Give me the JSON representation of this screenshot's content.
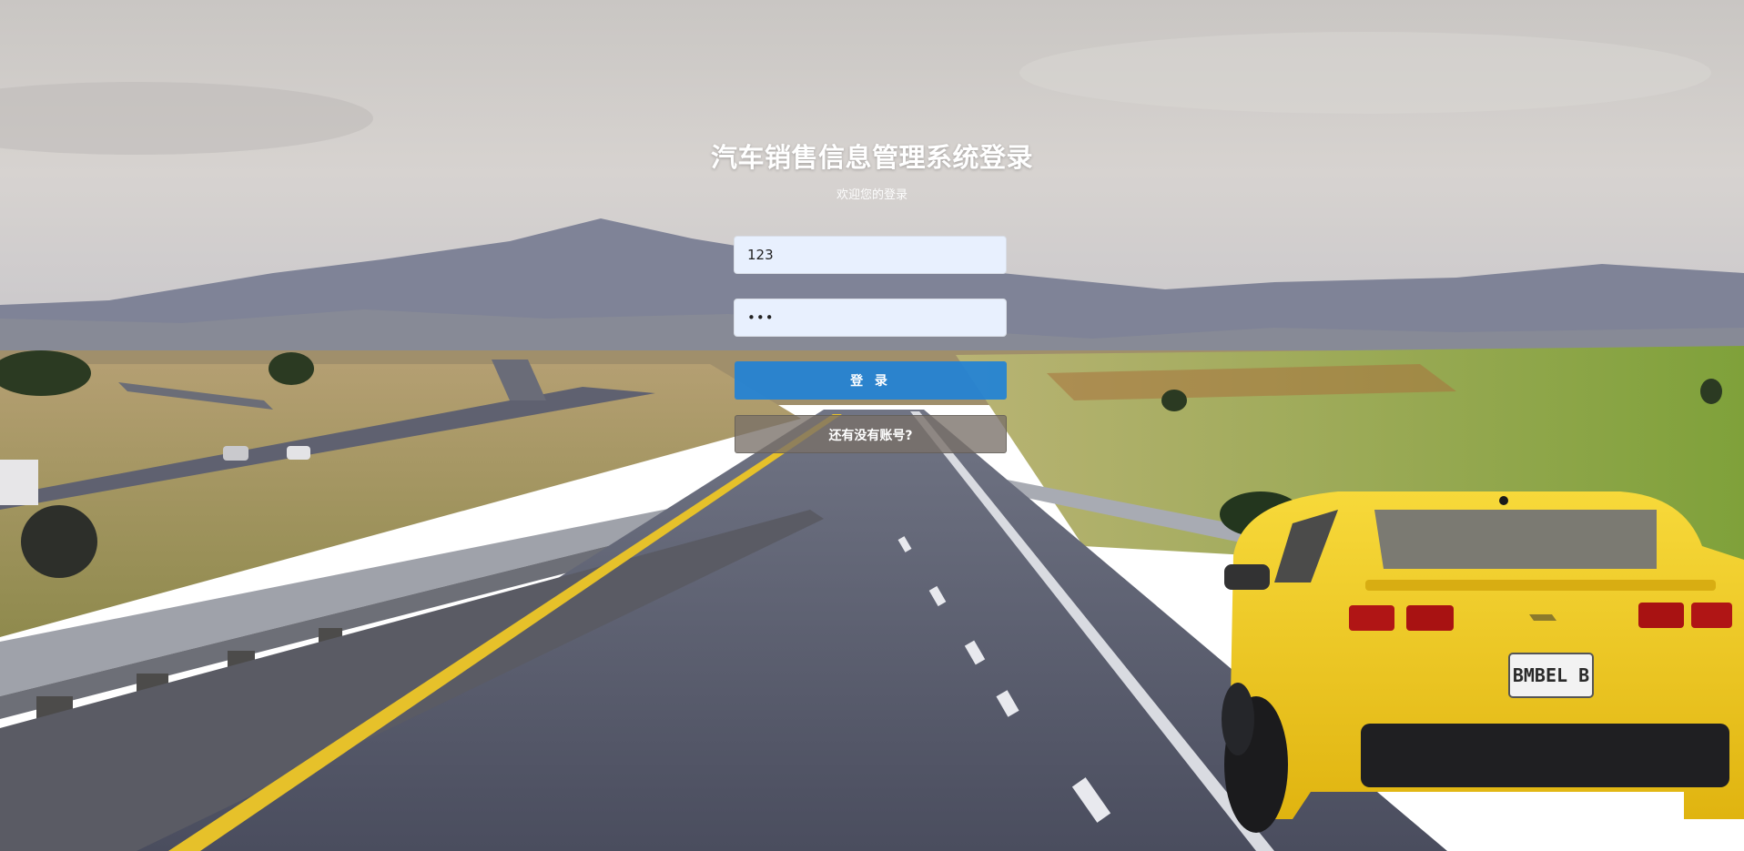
{
  "page": {
    "title": "汽车销售信息管理系统登录",
    "subtitle": "欢迎您的登录"
  },
  "form": {
    "username_value": "123",
    "password_value": "•••",
    "login_label": "登 录",
    "register_label": "还有没有账号?"
  },
  "colors": {
    "login_button": "#2182d6",
    "register_button": "#787068",
    "input_background": "#e8f0fe",
    "car": "#f3c91a"
  }
}
